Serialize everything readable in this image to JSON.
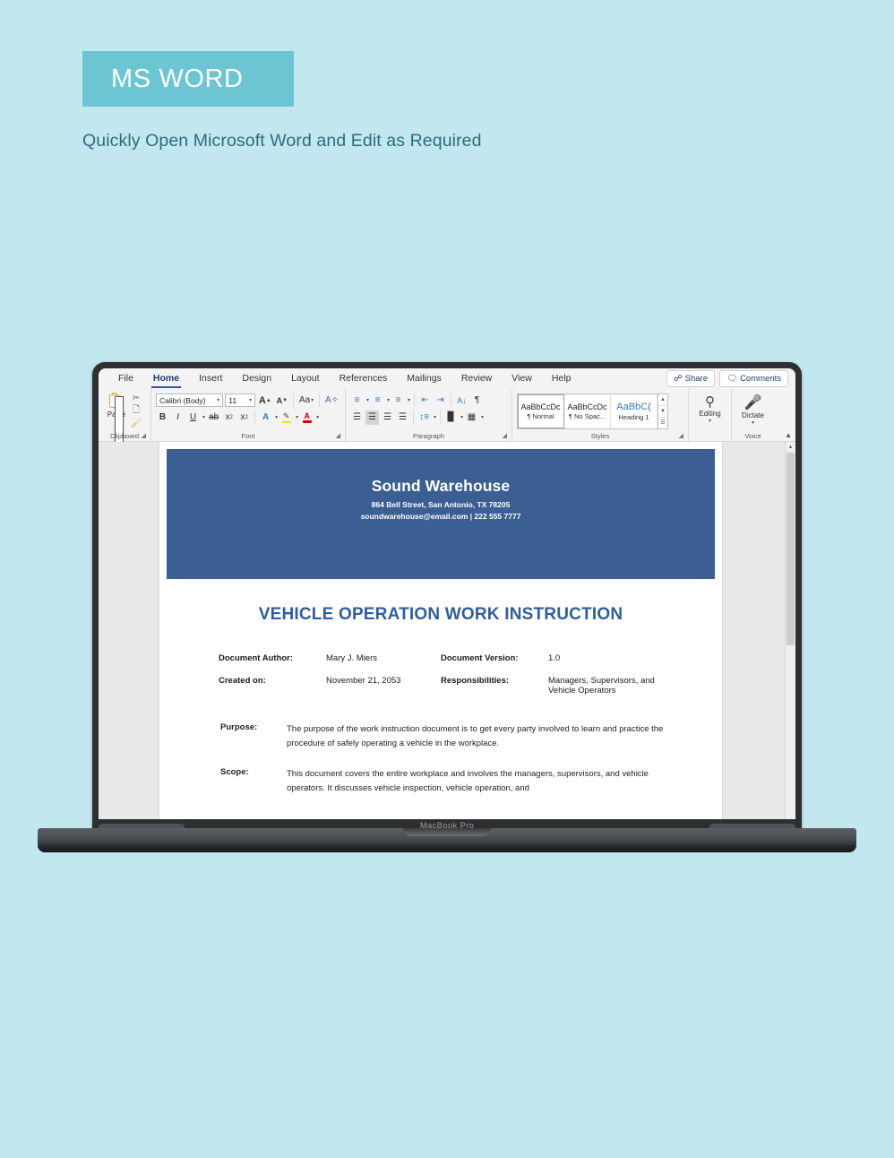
{
  "promo": {
    "banner_label": "MS WORD",
    "subtitle": "Quickly Open Microsoft Word and Edit as Required",
    "banner_color": "#6cc5d3",
    "background_color": "#c3e7ee",
    "subtitle_color": "#2a6e7c"
  },
  "device": {
    "brand": "MacBook Pro"
  },
  "word": {
    "tabs": [
      {
        "label": "File",
        "active": false
      },
      {
        "label": "Home",
        "active": true
      },
      {
        "label": "Insert",
        "active": false
      },
      {
        "label": "Design",
        "active": false
      },
      {
        "label": "Layout",
        "active": false
      },
      {
        "label": "References",
        "active": false
      },
      {
        "label": "Mailings",
        "active": false
      },
      {
        "label": "Review",
        "active": false
      },
      {
        "label": "View",
        "active": false
      },
      {
        "label": "Help",
        "active": false
      }
    ],
    "share_label": "Share",
    "comments_label": "Comments",
    "groups": {
      "clipboard": {
        "label": "Clipboard",
        "paste_label": "Paste",
        "cut_icon": "scissors-icon",
        "copy_icon": "copy-icon",
        "format_painter_icon": "paintbrush-icon"
      },
      "font": {
        "label": "Font",
        "font_name": "Calibri (Body)",
        "font_size": "11",
        "grow_font": "A",
        "shrink_font": "A",
        "change_case": "Aa",
        "clear_formatting_icon": "clear-formatting-icon",
        "bold": "B",
        "italic": "I",
        "underline": "U",
        "strikethrough": "ab",
        "subscript": "x",
        "superscript": "x",
        "text_effects": "A",
        "highlight": "A",
        "font_color": "A"
      },
      "paragraph": {
        "label": "Paragraph",
        "bullets_icon": "bullet-list-icon",
        "numbering_icon": "numbered-list-icon",
        "multilevel_icon": "multilevel-list-icon",
        "decrease_indent_icon": "decrease-indent-icon",
        "increase_indent_icon": "increase-indent-icon",
        "sort_icon": "sort-az-icon",
        "show_marks_icon": "pilcrow-icon",
        "align_left_icon": "align-left-icon",
        "align_center_icon": "align-center-icon",
        "align_right_icon": "align-right-icon",
        "justify_icon": "justify-icon",
        "line_spacing_icon": "line-spacing-icon",
        "shading_icon": "shading-icon",
        "borders_icon": "borders-icon"
      },
      "styles": {
        "label": "Styles",
        "items": [
          {
            "preview": "AaBbCcDc",
            "name": "¶ Normal",
            "selected": true
          },
          {
            "preview": "AaBbCcDc",
            "name": "¶ No Spac...",
            "selected": false
          },
          {
            "preview": "AaBbC(",
            "name": "Heading 1",
            "selected": false
          }
        ]
      },
      "editing": {
        "label": "",
        "button": "Editing",
        "icon": "magnifier-icon"
      },
      "voice": {
        "label": "Voice",
        "button": "Dictate",
        "icon": "microphone-icon"
      }
    }
  },
  "document": {
    "header": {
      "organization": "Sound Warehouse",
      "address": "864 Bell Street, San Antonio, TX 78205",
      "contact": "soundwarehouse@email.com | 222 555 7777",
      "band_color": "#3b5f92"
    },
    "title": "VEHICLE OPERATION WORK INSTRUCTION",
    "title_color": "#2f5d9e",
    "meta": [
      {
        "key": "Document Author:",
        "value": "Mary J. Miers"
      },
      {
        "key": "Document Version:",
        "value": "1.0"
      },
      {
        "key": "Created on:",
        "value": "November 21, 2053"
      },
      {
        "key": "Responsibilities:",
        "value": "Managers, Supervisors, and Vehicle Operators"
      }
    ],
    "sections": [
      {
        "key": "Purpose:",
        "value": "The purpose of the work instruction document is to get every party involved to learn and practice the procedure of safely operating a vehicle in the workplace."
      },
      {
        "key": "Scope:",
        "value": "This document covers the entire workplace and involves the managers, supervisors, and vehicle operators. It discusses vehicle inspection, vehicle operation, and"
      }
    ]
  }
}
